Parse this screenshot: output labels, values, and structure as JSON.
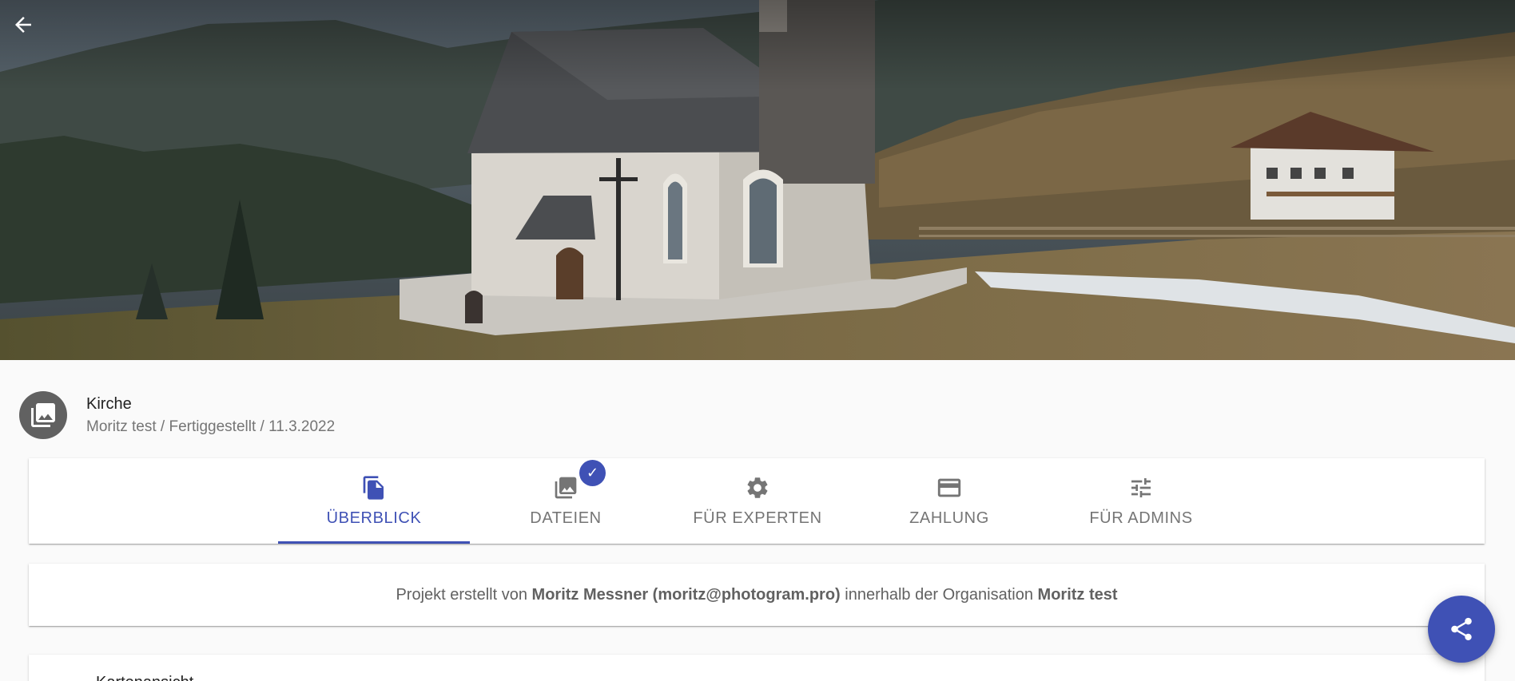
{
  "hero": {
    "alt": "Kirche"
  },
  "project": {
    "title": "Kirche",
    "subtitle": "Moritz test / Fertiggestellt / 11.3.2022"
  },
  "tabs": [
    {
      "label": "ÜBERBLICK",
      "icon": "file-copy-icon",
      "active": true
    },
    {
      "label": "DATEIEN",
      "icon": "photo-library-icon",
      "badge": "✓"
    },
    {
      "label": "FÜR EXPERTEN",
      "icon": "gear-icon"
    },
    {
      "label": "ZAHLUNG",
      "icon": "credit-card-icon"
    },
    {
      "label": "FÜR ADMINS",
      "icon": "tune-icon"
    }
  ],
  "info": {
    "prefix": "Projekt erstellt von",
    "creator": "Moritz Messner (moritz@photogram.pro)",
    "middle": "innerhalb der Organisation",
    "organization": "Moritz test"
  },
  "next_card": {
    "label": "Kartenansicht"
  },
  "colors": {
    "primary": "#3f51b5",
    "avatar_bg": "#616161",
    "page_bg": "#fafafa"
  }
}
